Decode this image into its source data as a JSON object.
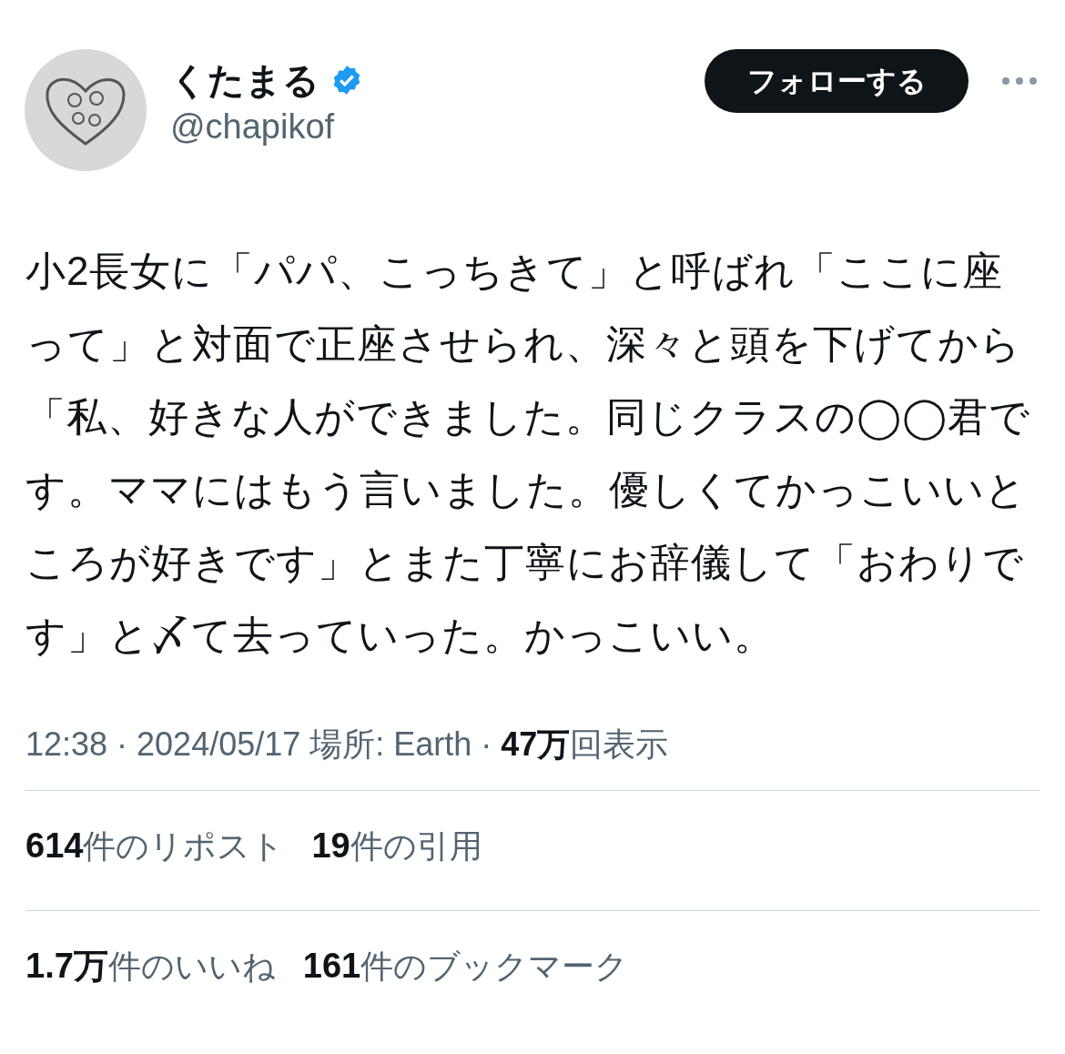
{
  "user": {
    "name": "くたまる",
    "verified": true,
    "handle": "@chapikof"
  },
  "follow_button": "フォローする",
  "tweet": {
    "text": "小2長女に「パパ、こっちきて」と呼ばれ「ここに座って」と対面で正座させられ、深々と頭を下げてから「私、好きな人ができました。同じクラスの◯◯君です。ママにはもう言いました。優しくてかっこいいところが好きです」とまた丁寧にお辞儀して「おわりです」と〆て去っていった。かっこいい。"
  },
  "meta": {
    "timestamp": "12:38 · 2024/05/17",
    "location": "場所: Earth",
    "separator": "·",
    "views_count": "47万",
    "views_label": "回表示"
  },
  "stats_rows": [
    [
      {
        "count": "614",
        "label": "件のリポスト"
      },
      {
        "count": "19",
        "label": "件の引用"
      }
    ],
    [
      {
        "count": "1.7万",
        "label": "件のいいね"
      },
      {
        "count": "161",
        "label": "件のブックマーク"
      }
    ]
  ]
}
